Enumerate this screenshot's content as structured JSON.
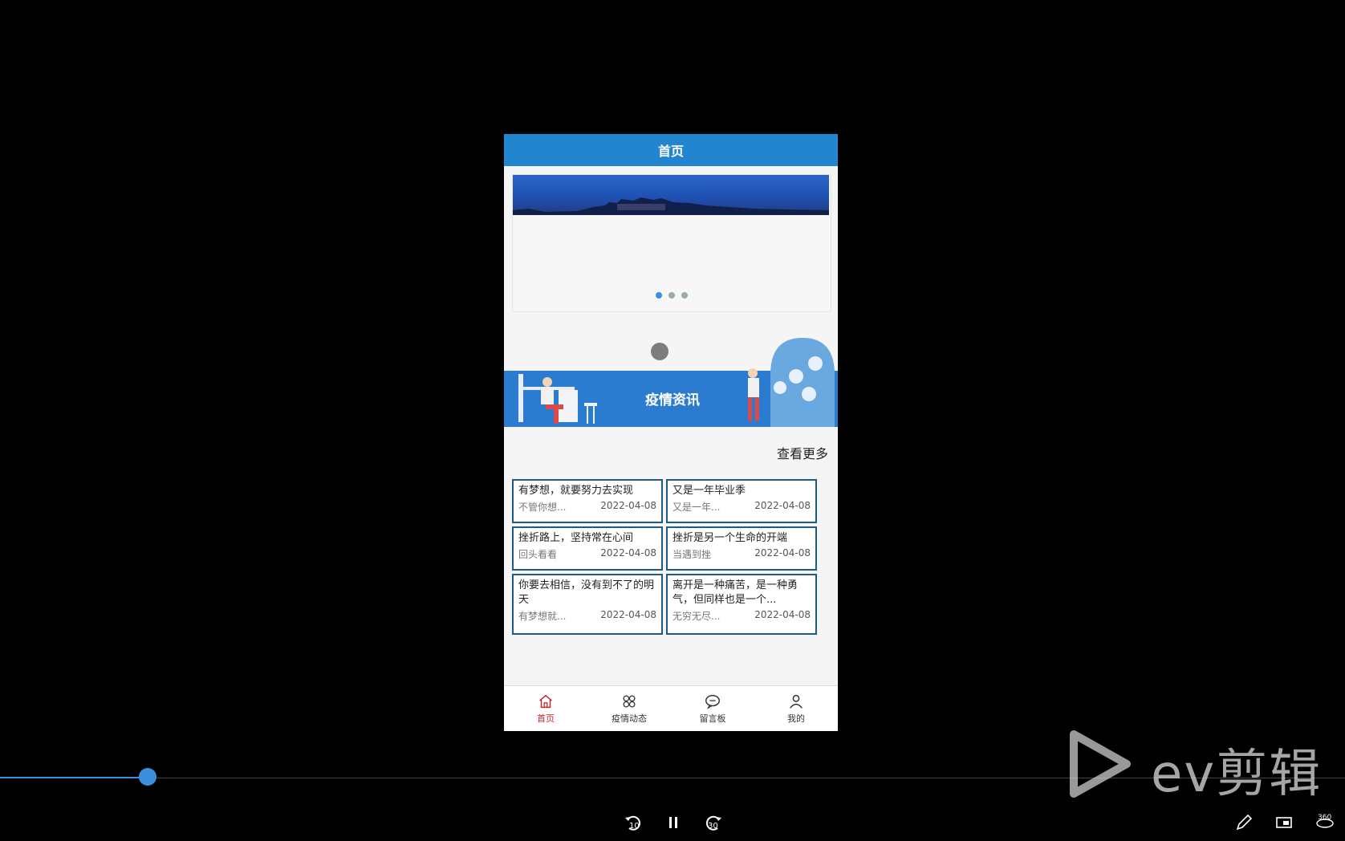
{
  "app": {
    "header_title": "首页",
    "section_title": "疫情资讯",
    "more_link": "查看更多",
    "banner_dots": 3,
    "banner_active_dot": 0
  },
  "news": [
    {
      "title": "有梦想，就要努力去实现",
      "summary": "不管你想...",
      "date": "2022-04-08"
    },
    {
      "title": "又是一年毕业季",
      "summary": "又是一年...",
      "date": "2022-04-08"
    },
    {
      "title": "挫折路上，坚持常在心间",
      "summary": "回头看看",
      "date": "2022-04-08"
    },
    {
      "title": "挫折是另一个生命的开端",
      "summary": "当遇到挫",
      "date": "2022-04-08"
    },
    {
      "title": "你要去相信，没有到不了的明天",
      "summary": "有梦想就...",
      "date": "2022-04-08"
    },
    {
      "title": "离开是一种痛苦，是一种勇气，但同样也是一个...",
      "summary": "无穷无尽...",
      "date": "2022-04-08"
    }
  ],
  "tabs": [
    {
      "label": "首页",
      "icon": "home-icon",
      "active": true
    },
    {
      "label": "疫情动态",
      "icon": "grid-icon",
      "active": false
    },
    {
      "label": "留言板",
      "icon": "chat-icon",
      "active": false
    },
    {
      "label": "我的",
      "icon": "user-icon",
      "active": false
    }
  ],
  "player": {
    "progress": 0.11,
    "rewind_label": "10",
    "forward_label": "30",
    "vr_label": "360",
    "watermark": "ev剪辑"
  },
  "colors": {
    "primary": "#2185d0",
    "banner": "#2b7bd0",
    "card_border": "#1d5a86",
    "active_tab": "#c62828",
    "progress": "#3b8ee0"
  }
}
